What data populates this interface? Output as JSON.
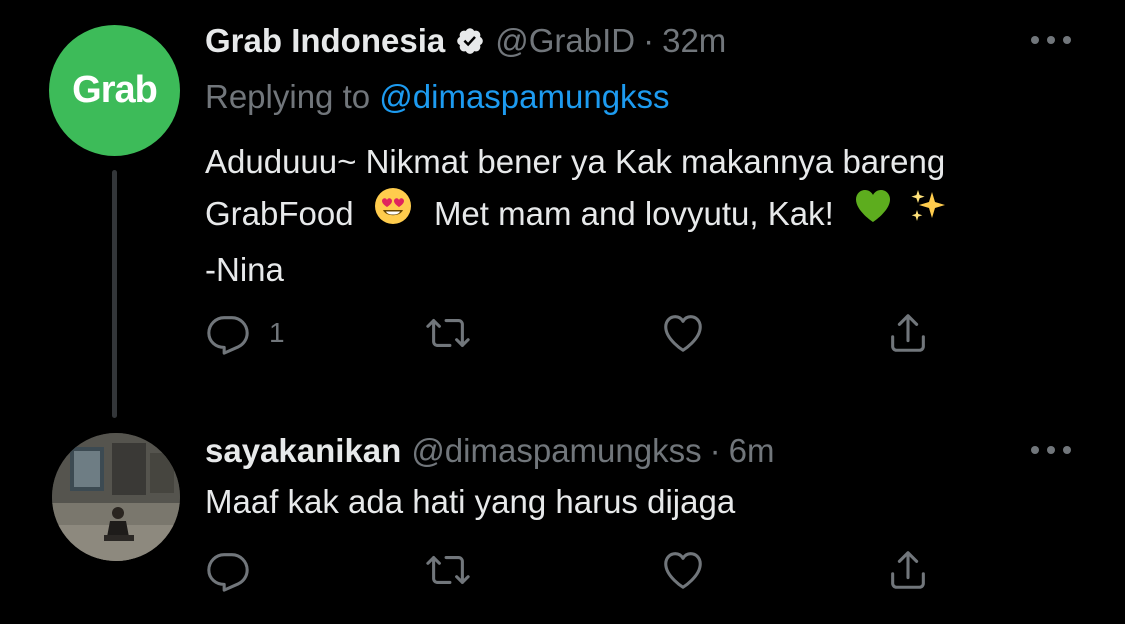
{
  "tweets": [
    {
      "name": "Grab Indonesia",
      "handle": "@GrabID",
      "separator": "·",
      "time": "32m",
      "avatar_logo": "Grab",
      "avatar_color": "#3dbb59",
      "verified": true,
      "replying_prefix": "Replying to",
      "replying_mention": "@dimaspamungkss",
      "text_line1": "Aduduuu~ Nikmat bener ya Kak makannya bareng",
      "text_line2a": "GrabFood",
      "emoji_1": "heart-eyes-emoji",
      "text_line2b": "Met mam and lovyutu, Kak!",
      "emoji_2": "green-heart-emoji",
      "emoji_3": "sparkles-emoji",
      "text_line3": "-Nina",
      "reply_count": "1"
    },
    {
      "name": "sayakanikan",
      "handle": "@dimaspamungkss",
      "separator": "·",
      "time": "6m",
      "text": "Maaf kak ada hati yang harus dijaga",
      "reply_count": ""
    }
  ],
  "icons": {
    "reply": "reply-icon",
    "retweet": "retweet-icon",
    "like": "like-icon",
    "share": "share-icon",
    "more": "more-options-icon"
  },
  "colors": {
    "background": "#000000",
    "primary_text": "#e7e9ea",
    "secondary_text": "#71767b",
    "link": "#1d9bf0",
    "thread_line": "#333639"
  }
}
